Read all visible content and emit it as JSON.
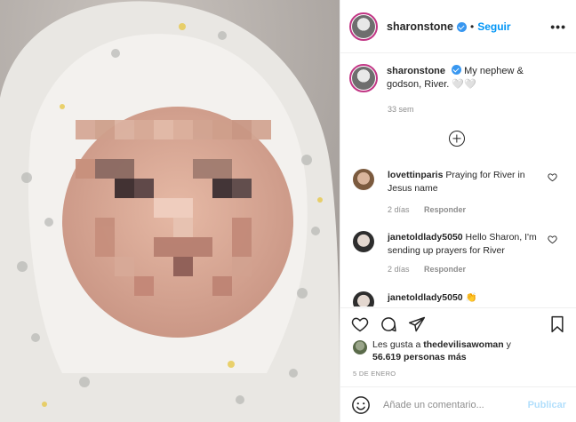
{
  "post": {
    "username": "sharonstone",
    "follow_label": "Seguir",
    "separator": "•",
    "more_label": "•••",
    "caption_text": "My nephew & godson, River. 🤍🤍",
    "caption_time": "33 sem"
  },
  "comments": [
    {
      "username": "lovettinparis",
      "text": "Praying for River in Jesus name",
      "time": "2 días",
      "reply": "Responder"
    },
    {
      "username": "janetoldlady5050",
      "text": "Hello Sharon, I'm sending up prayers for River",
      "time": "2 días",
      "reply": "Responder"
    },
    {
      "username": "janetoldlady5050",
      "text": "👏"
    }
  ],
  "likes": {
    "prefix": "Les gusta a ",
    "user": "thedevilisawoman",
    "suffix": " y",
    "count_text": "56.619 personas más"
  },
  "date": "5 DE ENERO",
  "add_comment": {
    "placeholder": "Añade un comentario...",
    "publish": "Publicar"
  },
  "icons": [
    "heart-icon",
    "comment-icon",
    "share-icon",
    "bookmark-icon",
    "emoji-icon",
    "add-icon"
  ],
  "colors": {
    "accent": "#0095f6",
    "verified": "#3897f0",
    "muted": "#8e8e8e"
  }
}
